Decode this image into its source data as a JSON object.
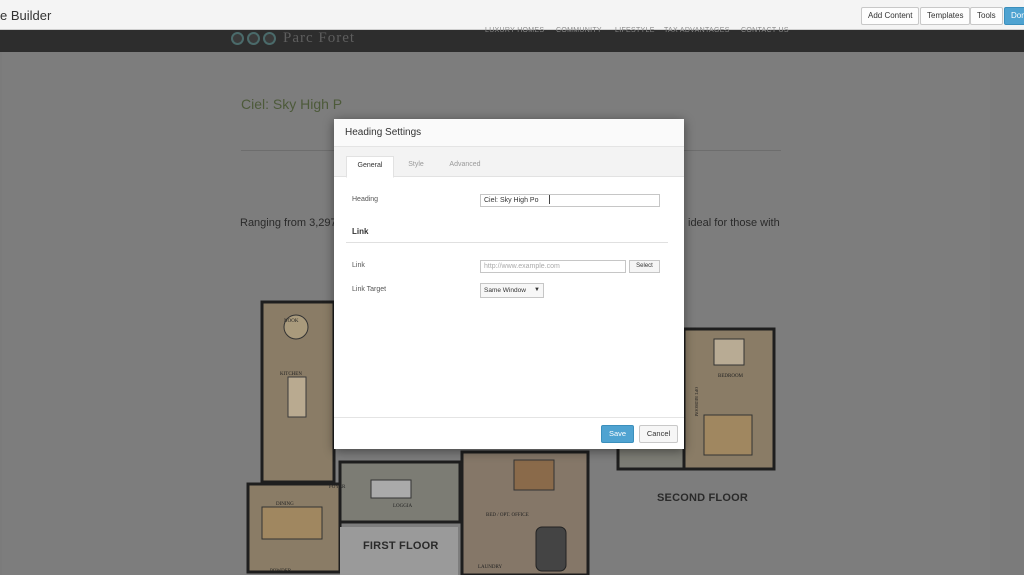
{
  "builder": {
    "title": "e Builder",
    "buttons": [
      "Add Content",
      "Templates",
      "Tools",
      "Don"
    ]
  },
  "site": {
    "logo_text": "Parc Foret",
    "nav": [
      "LUXURY HOMES",
      "COMMUNITY",
      "LIFESTYLE",
      "TAX ADVANTAGES",
      "CONTACT US"
    ],
    "page_heading": "Ciel: Sky High P",
    "body_left": "Ranging from 3,297",
    "body_right": "ideal for those with",
    "first_floor": "FIRST FLOOR",
    "second_floor": "SECOND FLOOR",
    "plan_rooms": [
      "NOOK",
      "KITCHEN",
      "FOYER",
      "DINING",
      "LOGGIA",
      "BED / OPT. OFFICE",
      "LAUNDRY",
      "POWDER",
      "BEDROOM",
      "OPT. BEDROOM"
    ]
  },
  "modal": {
    "title": "Heading Settings",
    "tabs": [
      "General",
      "Style",
      "Advanced"
    ],
    "heading_label": "Heading",
    "heading_value": "Ciel: Sky High Po",
    "section_link": "Link",
    "link_label": "Link",
    "link_placeholder": "http://www.example.com",
    "select_button": "Select",
    "link_target_label": "Link Target",
    "link_target_value": "Same Window",
    "save": "Save",
    "cancel": "Cancel"
  },
  "colors": {
    "primary": "#4fa3d1",
    "overlay": "#7b7b7b",
    "header_dark": "#2d2d2d"
  }
}
